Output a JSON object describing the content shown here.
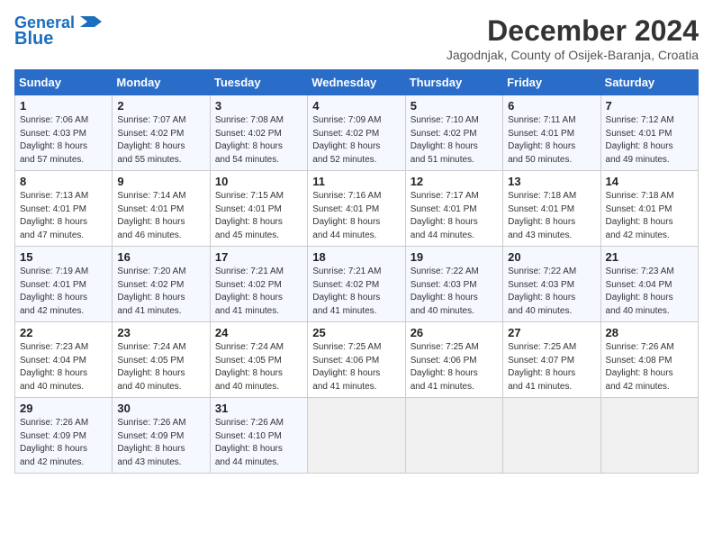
{
  "logo": {
    "line1": "General",
    "line2": "Blue"
  },
  "title": "December 2024",
  "subtitle": "Jagodnjak, County of Osijek-Baranja, Croatia",
  "weekdays": [
    "Sunday",
    "Monday",
    "Tuesday",
    "Wednesday",
    "Thursday",
    "Friday",
    "Saturday"
  ],
  "weeks": [
    [
      {
        "day": "1",
        "info": "Sunrise: 7:06 AM\nSunset: 4:03 PM\nDaylight: 8 hours\nand 57 minutes."
      },
      {
        "day": "2",
        "info": "Sunrise: 7:07 AM\nSunset: 4:02 PM\nDaylight: 8 hours\nand 55 minutes."
      },
      {
        "day": "3",
        "info": "Sunrise: 7:08 AM\nSunset: 4:02 PM\nDaylight: 8 hours\nand 54 minutes."
      },
      {
        "day": "4",
        "info": "Sunrise: 7:09 AM\nSunset: 4:02 PM\nDaylight: 8 hours\nand 52 minutes."
      },
      {
        "day": "5",
        "info": "Sunrise: 7:10 AM\nSunset: 4:02 PM\nDaylight: 8 hours\nand 51 minutes."
      },
      {
        "day": "6",
        "info": "Sunrise: 7:11 AM\nSunset: 4:01 PM\nDaylight: 8 hours\nand 50 minutes."
      },
      {
        "day": "7",
        "info": "Sunrise: 7:12 AM\nSunset: 4:01 PM\nDaylight: 8 hours\nand 49 minutes."
      }
    ],
    [
      {
        "day": "8",
        "info": "Sunrise: 7:13 AM\nSunset: 4:01 PM\nDaylight: 8 hours\nand 47 minutes."
      },
      {
        "day": "9",
        "info": "Sunrise: 7:14 AM\nSunset: 4:01 PM\nDaylight: 8 hours\nand 46 minutes."
      },
      {
        "day": "10",
        "info": "Sunrise: 7:15 AM\nSunset: 4:01 PM\nDaylight: 8 hours\nand 45 minutes."
      },
      {
        "day": "11",
        "info": "Sunrise: 7:16 AM\nSunset: 4:01 PM\nDaylight: 8 hours\nand 44 minutes."
      },
      {
        "day": "12",
        "info": "Sunrise: 7:17 AM\nSunset: 4:01 PM\nDaylight: 8 hours\nand 44 minutes."
      },
      {
        "day": "13",
        "info": "Sunrise: 7:18 AM\nSunset: 4:01 PM\nDaylight: 8 hours\nand 43 minutes."
      },
      {
        "day": "14",
        "info": "Sunrise: 7:18 AM\nSunset: 4:01 PM\nDaylight: 8 hours\nand 42 minutes."
      }
    ],
    [
      {
        "day": "15",
        "info": "Sunrise: 7:19 AM\nSunset: 4:01 PM\nDaylight: 8 hours\nand 42 minutes."
      },
      {
        "day": "16",
        "info": "Sunrise: 7:20 AM\nSunset: 4:02 PM\nDaylight: 8 hours\nand 41 minutes."
      },
      {
        "day": "17",
        "info": "Sunrise: 7:21 AM\nSunset: 4:02 PM\nDaylight: 8 hours\nand 41 minutes."
      },
      {
        "day": "18",
        "info": "Sunrise: 7:21 AM\nSunset: 4:02 PM\nDaylight: 8 hours\nand 41 minutes."
      },
      {
        "day": "19",
        "info": "Sunrise: 7:22 AM\nSunset: 4:03 PM\nDaylight: 8 hours\nand 40 minutes."
      },
      {
        "day": "20",
        "info": "Sunrise: 7:22 AM\nSunset: 4:03 PM\nDaylight: 8 hours\nand 40 minutes."
      },
      {
        "day": "21",
        "info": "Sunrise: 7:23 AM\nSunset: 4:04 PM\nDaylight: 8 hours\nand 40 minutes."
      }
    ],
    [
      {
        "day": "22",
        "info": "Sunrise: 7:23 AM\nSunset: 4:04 PM\nDaylight: 8 hours\nand 40 minutes."
      },
      {
        "day": "23",
        "info": "Sunrise: 7:24 AM\nSunset: 4:05 PM\nDaylight: 8 hours\nand 40 minutes."
      },
      {
        "day": "24",
        "info": "Sunrise: 7:24 AM\nSunset: 4:05 PM\nDaylight: 8 hours\nand 40 minutes."
      },
      {
        "day": "25",
        "info": "Sunrise: 7:25 AM\nSunset: 4:06 PM\nDaylight: 8 hours\nand 41 minutes."
      },
      {
        "day": "26",
        "info": "Sunrise: 7:25 AM\nSunset: 4:06 PM\nDaylight: 8 hours\nand 41 minutes."
      },
      {
        "day": "27",
        "info": "Sunrise: 7:25 AM\nSunset: 4:07 PM\nDaylight: 8 hours\nand 41 minutes."
      },
      {
        "day": "28",
        "info": "Sunrise: 7:26 AM\nSunset: 4:08 PM\nDaylight: 8 hours\nand 42 minutes."
      }
    ],
    [
      {
        "day": "29",
        "info": "Sunrise: 7:26 AM\nSunset: 4:09 PM\nDaylight: 8 hours\nand 42 minutes."
      },
      {
        "day": "30",
        "info": "Sunrise: 7:26 AM\nSunset: 4:09 PM\nDaylight: 8 hours\nand 43 minutes."
      },
      {
        "day": "31",
        "info": "Sunrise: 7:26 AM\nSunset: 4:10 PM\nDaylight: 8 hours\nand 44 minutes."
      },
      {
        "day": "",
        "info": ""
      },
      {
        "day": "",
        "info": ""
      },
      {
        "day": "",
        "info": ""
      },
      {
        "day": "",
        "info": ""
      }
    ]
  ]
}
